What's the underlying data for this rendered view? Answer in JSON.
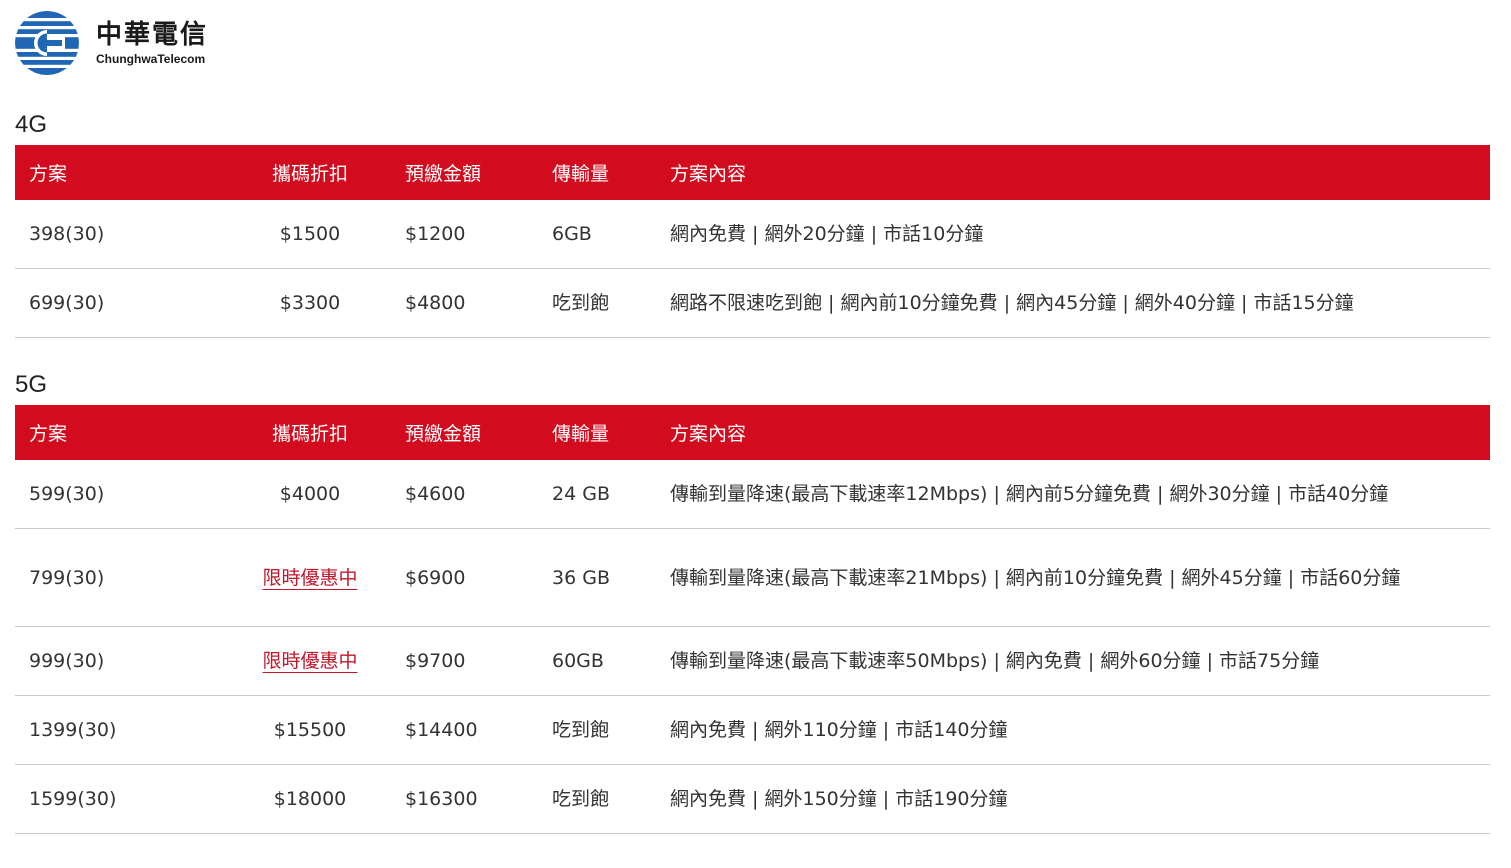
{
  "brand": {
    "name_cn": "中華電信",
    "name_en": "ChunghwaTelecom",
    "logo_color": "#1f66b4"
  },
  "columns": {
    "plan": "方案",
    "discount": "攜碼折扣",
    "prepay": "預繳金額",
    "data": "傳輸量",
    "content": "方案內容"
  },
  "colors": {
    "header_bg": "#d30b1e",
    "promo_link": "#c0172b"
  },
  "sections": [
    {
      "title": "4G",
      "rows": [
        {
          "plan": "398(30)",
          "discount": "$1500",
          "prepay": "$1200",
          "data": "6GB",
          "content": "網內免費 | 網外20分鐘 | 市話10分鐘"
        },
        {
          "plan": "699(30)",
          "discount": "$3300",
          "prepay": "$4800",
          "data": "吃到飽",
          "content": "網路不限速吃到飽 | 網內前10分鐘免費 | 網內45分鐘 | 網外40分鐘 | 市話15分鐘"
        }
      ]
    },
    {
      "title": "5G",
      "rows": [
        {
          "plan": "599(30)",
          "discount": "$4000",
          "prepay": "$4600",
          "data": "24 GB",
          "content": "傳輸到量降速(最高下載速率12Mbps) | 網內前5分鐘免費 | 網外30分鐘 | 市話40分鐘"
        },
        {
          "plan": "799(30)",
          "discount": "限時優惠中",
          "prepay": "$6900",
          "data": "36 GB",
          "content": "傳輸到量降速(最高下載速率21Mbps) | 網內前10分鐘免費 | 網外45分鐘 | 市話60分鐘"
        },
        {
          "plan": "999(30)",
          "discount": "限時優惠中",
          "prepay": "$9700",
          "data": "60GB",
          "content": "傳輸到量降速(最高下載速率50Mbps) | 網內免費 | 網外60分鐘 | 市話75分鐘"
        },
        {
          "plan": "1399(30)",
          "discount": "$15500",
          "prepay": "$14400",
          "data": "吃到飽",
          "content": "網內免費 | 網外110分鐘 | 市話140分鐘"
        },
        {
          "plan": "1599(30)",
          "discount": "$18000",
          "prepay": "$16300",
          "data": "吃到飽",
          "content": "網內免費 | 網外150分鐘 | 市話190分鐘"
        }
      ]
    }
  ]
}
